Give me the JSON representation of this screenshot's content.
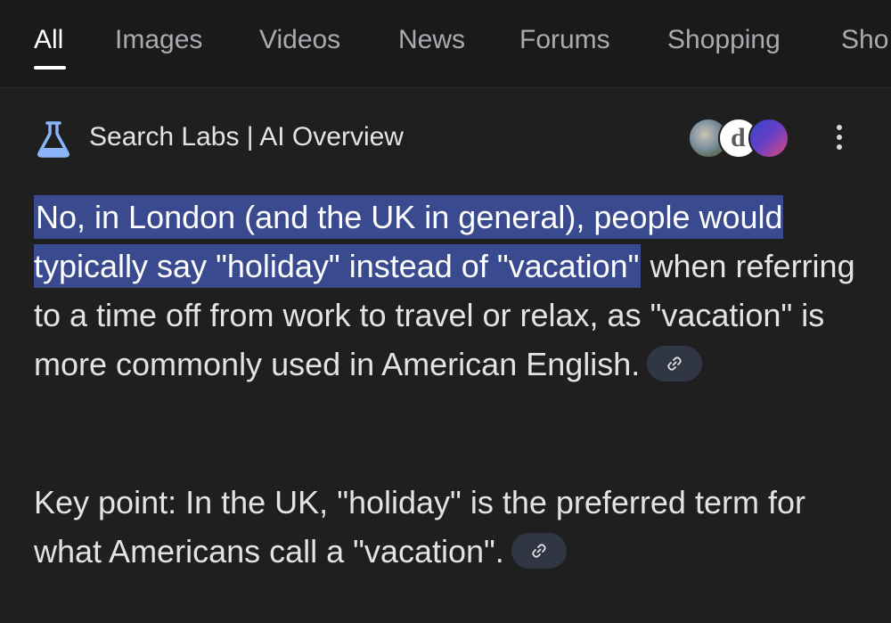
{
  "tabs": [
    {
      "label": "All",
      "active": true
    },
    {
      "label": "Images"
    },
    {
      "label": "Videos"
    },
    {
      "label": "News"
    },
    {
      "label": "Forums"
    },
    {
      "label": "Shopping"
    },
    {
      "label": "Sho"
    }
  ],
  "ai_overview": {
    "title": "Search Labs | AI Overview",
    "icon": "flask-icon",
    "avatar_glyph": "d",
    "highlighted_text": "No, in London (and the UK in general), people would typically say \"holiday\" instead of \"vacation\"",
    "rest_text": " when referring to a time off from work to travel or relax, as \"vacation\" is more commonly used in American English.",
    "key_point": "Key point: In the UK, \"holiday\" is the preferred term for what Americans call a \"vacation\"."
  },
  "colors": {
    "background": "#1f1f1f",
    "highlight": "#3a4a8f",
    "citation_chip": "#303643",
    "flask_icon": "#8ab4f8"
  }
}
